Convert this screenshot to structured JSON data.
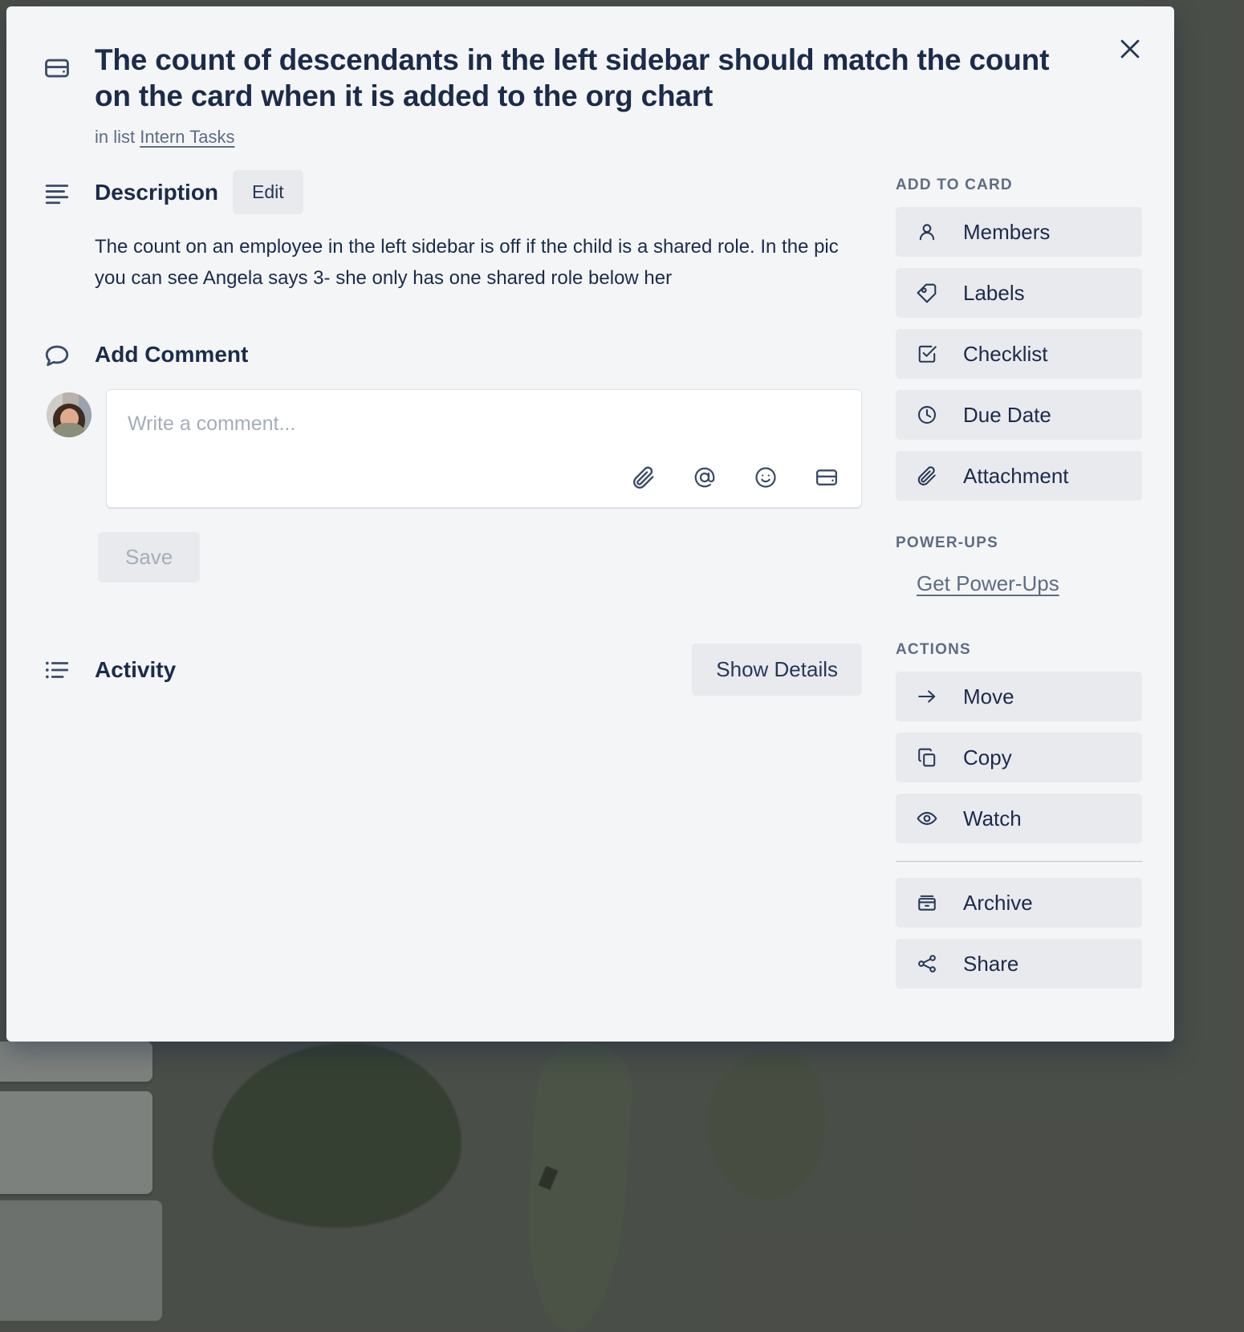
{
  "background": {
    "description": "blurred dark green plant leaf photo board background",
    "scrim_color": "#3c3f3a"
  },
  "modal": {
    "close_icon": "close-icon",
    "card_icon": "card-window-icon",
    "title": "The count of descendants in the left sidebar should match the count on the card when it is added to the org chart",
    "in_list_prefix": "in list",
    "list_name": "Intern Tasks"
  },
  "description": {
    "icon": "description-lines-icon",
    "heading": "Description",
    "edit_label": "Edit",
    "body": "The count on an employee in the left sidebar is off if the child is a shared role. In the pic you can see Angela says 3- she only has one shared role below her"
  },
  "comment": {
    "icon": "comment-bubble-icon",
    "heading": "Add Comment",
    "avatar": "user-avatar-photo",
    "placeholder": "Write a comment...",
    "value": "",
    "save_label": "Save",
    "tools": [
      {
        "name": "attach-icon",
        "glyph": "paperclip"
      },
      {
        "name": "mention-icon",
        "glyph": "at"
      },
      {
        "name": "emoji-icon",
        "glyph": "smiley"
      },
      {
        "name": "card-icon",
        "glyph": "card"
      }
    ]
  },
  "activity": {
    "icon": "activity-list-icon",
    "heading": "Activity",
    "show_details_label": "Show Details",
    "entries": []
  },
  "sidebar": {
    "add_to_card": {
      "heading": "ADD TO CARD",
      "items": [
        {
          "label": "Members",
          "icon": "person-icon"
        },
        {
          "label": "Labels",
          "icon": "tag-icon"
        },
        {
          "label": "Checklist",
          "icon": "checkbox-icon"
        },
        {
          "label": "Due Date",
          "icon": "clock-icon"
        },
        {
          "label": "Attachment",
          "icon": "paperclip-icon"
        }
      ]
    },
    "power_ups": {
      "heading": "POWER-UPS",
      "link_label": "Get Power-Ups"
    },
    "actions": {
      "heading": "ACTIONS",
      "items": [
        {
          "label": "Move",
          "icon": "arrow-right-icon"
        },
        {
          "label": "Copy",
          "icon": "copy-icon"
        },
        {
          "label": "Watch",
          "icon": "eye-icon"
        }
      ],
      "items_after_divider": [
        {
          "label": "Archive",
          "icon": "archive-icon"
        },
        {
          "label": "Share",
          "icon": "share-icon"
        }
      ]
    }
  },
  "colors": {
    "modal_bg": "#f4f5f7",
    "text_dark": "#1b2b4b",
    "text_muted": "#5e6c84",
    "button_bg": "#e9eaee",
    "input_bg": "#ffffff",
    "border": "#dfe1e6"
  }
}
